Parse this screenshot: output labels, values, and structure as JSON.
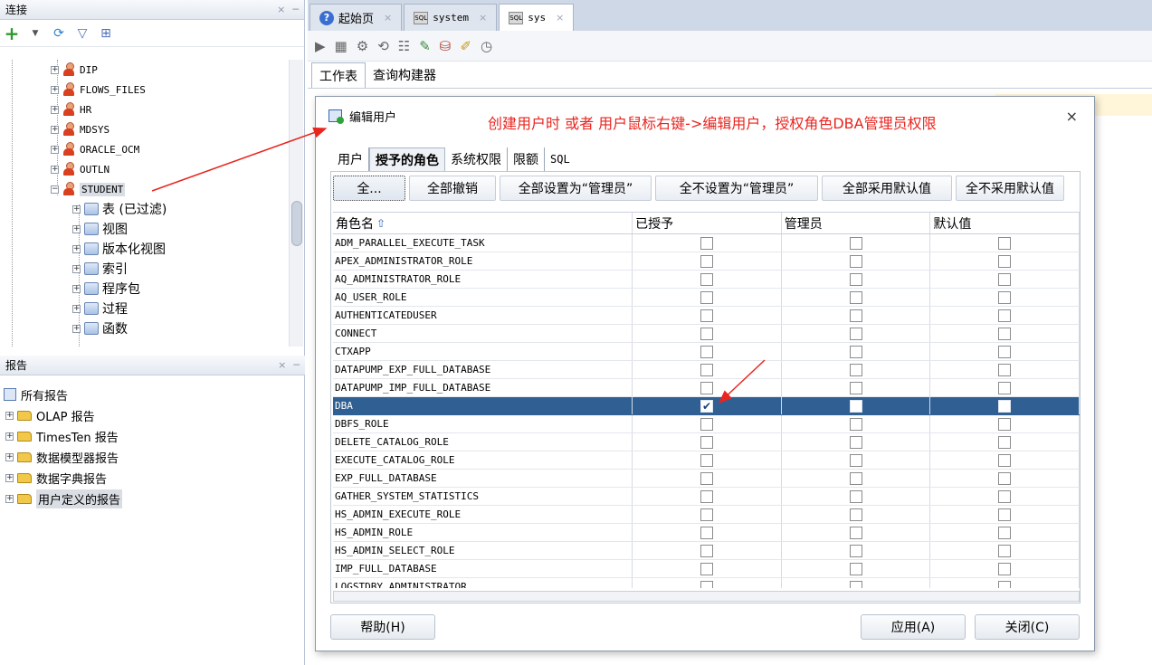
{
  "connections_panel": {
    "title": "连接",
    "close_glyph": "×",
    "min_glyph": "─",
    "toolbar": [
      "add-icon",
      "refresh-icon",
      "filter-icon",
      "schema-browser-icon"
    ],
    "tree": [
      {
        "label": "DIP",
        "type": "user"
      },
      {
        "label": "FLOWS_FILES",
        "type": "user"
      },
      {
        "label": "HR",
        "type": "user"
      },
      {
        "label": "MDSYS",
        "type": "user"
      },
      {
        "label": "ORACLE_OCM",
        "type": "user"
      },
      {
        "label": "OUTLN",
        "type": "user"
      },
      {
        "label": "STUDENT",
        "type": "user",
        "expanded": true
      },
      {
        "label": "表 (已过滤)",
        "type": "child"
      },
      {
        "label": "视图",
        "type": "child"
      },
      {
        "label": "版本化视图",
        "type": "child"
      },
      {
        "label": "索引",
        "type": "child"
      },
      {
        "label": "程序包",
        "type": "child"
      },
      {
        "label": "过程",
        "type": "child"
      },
      {
        "label": "函数",
        "type": "child"
      }
    ]
  },
  "reports_panel": {
    "title": "报告",
    "close_glyph": "×",
    "min_glyph": "─",
    "items": [
      "所有报告",
      "OLAP 报告",
      "TimesTen 报告",
      "数据模型器报告",
      "数据字典报告",
      "用户定义的报告"
    ]
  },
  "doc_tabs": [
    {
      "label": "起始页",
      "icon": "help-icon",
      "active": false
    },
    {
      "label": "system",
      "icon": "sql-db-icon",
      "active": false
    },
    {
      "label": "sys",
      "icon": "sql-db-icon",
      "active": true
    }
  ],
  "tab_close_glyph": "×",
  "sub_tabs": [
    {
      "label": "工作表",
      "active": true
    },
    {
      "label": "查询构建器",
      "active": false
    }
  ],
  "dialog": {
    "title": "编辑用户",
    "annotation": "创建用户时 或者 用户鼠标右键->编辑用户，授权角色DBA管理员权限",
    "close_glyph": "×",
    "tabs": [
      {
        "label": "用户",
        "active": false
      },
      {
        "label": "授予的角色",
        "active": true
      },
      {
        "label": "系统权限",
        "active": false
      },
      {
        "label": "限额",
        "active": false
      },
      {
        "label": "SQL",
        "active": false
      }
    ],
    "action_buttons": [
      "全...",
      "全部撤销",
      "全部设置为“管理员”",
      "全不设置为“管理员”",
      "全部采用默认值",
      "全不采用默认值"
    ],
    "columns": [
      "角色名",
      "已授予",
      "管理员",
      "默认值"
    ],
    "roles": [
      {
        "name": "ADM_PARALLEL_EXECUTE_TASK",
        "granted": false,
        "admin": false,
        "default": false
      },
      {
        "name": "APEX_ADMINISTRATOR_ROLE",
        "granted": false,
        "admin": false,
        "default": false
      },
      {
        "name": "AQ_ADMINISTRATOR_ROLE",
        "granted": false,
        "admin": false,
        "default": false
      },
      {
        "name": "AQ_USER_ROLE",
        "granted": false,
        "admin": false,
        "default": false
      },
      {
        "name": "AUTHENTICATEDUSER",
        "granted": false,
        "admin": false,
        "default": false
      },
      {
        "name": "CONNECT",
        "granted": false,
        "admin": false,
        "default": false
      },
      {
        "name": "CTXAPP",
        "granted": false,
        "admin": false,
        "default": false
      },
      {
        "name": "DATAPUMP_EXP_FULL_DATABASE",
        "granted": false,
        "admin": false,
        "default": false
      },
      {
        "name": "DATAPUMP_IMP_FULL_DATABASE",
        "granted": false,
        "admin": false,
        "default": false
      },
      {
        "name": "DBA",
        "granted": true,
        "admin": false,
        "default": false,
        "selected": true
      },
      {
        "name": "DBFS_ROLE",
        "granted": false,
        "admin": false,
        "default": false
      },
      {
        "name": "DELETE_CATALOG_ROLE",
        "granted": false,
        "admin": false,
        "default": false
      },
      {
        "name": "EXECUTE_CATALOG_ROLE",
        "granted": false,
        "admin": false,
        "default": false
      },
      {
        "name": "EXP_FULL_DATABASE",
        "granted": false,
        "admin": false,
        "default": false
      },
      {
        "name": "GATHER_SYSTEM_STATISTICS",
        "granted": false,
        "admin": false,
        "default": false
      },
      {
        "name": "HS_ADMIN_EXECUTE_ROLE",
        "granted": false,
        "admin": false,
        "default": false
      },
      {
        "name": "HS_ADMIN_ROLE",
        "granted": false,
        "admin": false,
        "default": false
      },
      {
        "name": "HS_ADMIN_SELECT_ROLE",
        "granted": false,
        "admin": false,
        "default": false
      },
      {
        "name": "IMP_FULL_DATABASE",
        "granted": false,
        "admin": false,
        "default": false
      },
      {
        "name": "LOGSTDBY_ADMINISTRATOR",
        "granted": false,
        "admin": false,
        "default": false
      }
    ],
    "help_button": "帮助(H)",
    "apply_button": "应用(A)",
    "close_button": "关闭(C)"
  },
  "colors": {
    "annotation": "#e8251f",
    "selection": "#305f93",
    "tab_strip": "#cfd8e6"
  }
}
